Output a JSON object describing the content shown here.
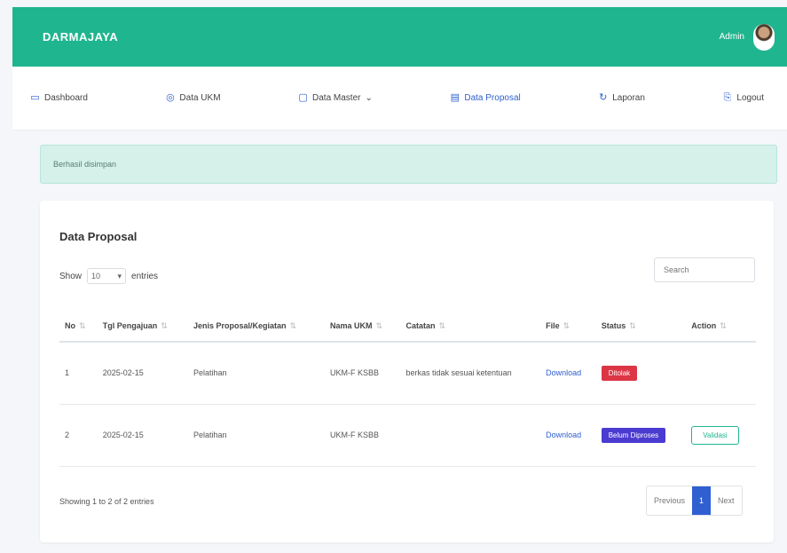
{
  "header": {
    "brand": "DARMAJAYA",
    "user_name": "Admin"
  },
  "nav": [
    {
      "label": "Dashboard",
      "icon": "monitor-icon",
      "active": false
    },
    {
      "label": "Data UKM",
      "icon": "globe-icon",
      "active": false
    },
    {
      "label": "Data Master",
      "icon": "folder-icon",
      "active": false
    },
    {
      "label": "Data Proposal",
      "icon": "document-icon",
      "active": true
    },
    {
      "label": "Laporan",
      "icon": "refresh-icon",
      "active": false
    },
    {
      "label": "Logout",
      "icon": "logout-icon",
      "active": false
    }
  ],
  "alert": {
    "text": "Berhasil disimpan"
  },
  "card": {
    "title": "Data Proposal",
    "show_label": "Show",
    "entries_value": "10",
    "entries_label": "entries",
    "search_placeholder": "Search"
  },
  "table": {
    "columns": [
      "No",
      "Tgl Pengajuan",
      "Jenis Proposal/Kegiatan",
      "Nama UKM",
      "Catatan",
      "File",
      "Status",
      "Action"
    ],
    "rows": [
      {
        "no": "1",
        "date": "2025-02-15",
        "type": "Pelatihan",
        "ukm": "UKM-F KSBB",
        "note": "berkas tidak sesuai ketentuan",
        "file": "Download",
        "status": "Ditolak",
        "status_color": "#dc3545",
        "action": ""
      },
      {
        "no": "2",
        "date": "2025-02-15",
        "type": "Pelatihan",
        "ukm": "UKM-F KSBB",
        "note": "",
        "file": "Download",
        "status": "Belum Diproses",
        "status_color": "#4b3bd1",
        "action": "Validasi"
      }
    ]
  },
  "footer": {
    "info": "Showing 1 to 2 of 2 entries",
    "prev": "Previous",
    "page": "1",
    "next": "Next"
  },
  "colors": {
    "primary": "#1fb58e",
    "link": "#2f5fd0",
    "danger": "#dc3545",
    "pending": "#4b3bd1"
  }
}
